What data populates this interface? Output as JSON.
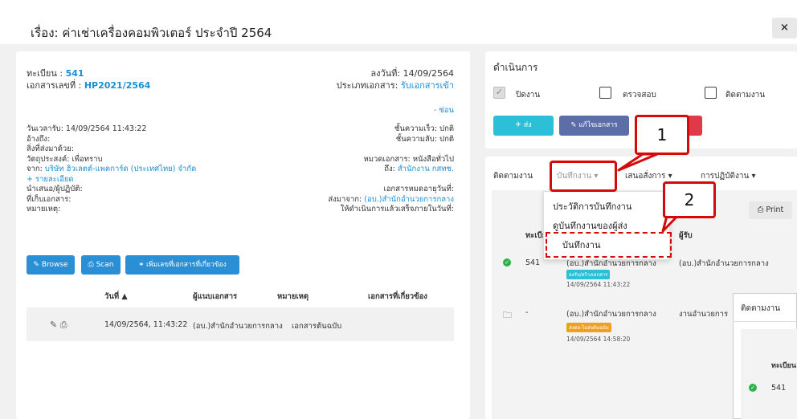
{
  "header": {
    "title": "เรื่อง: ค่าเช่าเครื่องคอมพิวเตอร์ ประจำปี 2564",
    "close": "×"
  },
  "doc": {
    "reg_label": "ทะเบียน :",
    "reg_value": "541",
    "docno_label": "เอกสารเลขที่ :",
    "docno_value": "HP2021/2564",
    "sign_date": "ลงวันที่: 14/09/2564",
    "doctype_label": "ประเภทเอกสาร:",
    "doctype_value": "รับเอกสารเข้า",
    "hide": "- ซ่อน",
    "received": "วันเวลารับ: 14/09/2564 11:43:22",
    "ref": "อ้างถึง:",
    "attach": "สิ่งที่ส่งมาด้วย:",
    "purpose": "วัตถุประสงค์: เพื่อทราบ",
    "from_label": "จาก:",
    "from_value": "บริษัท ฮิวเลตต์-แพคการ์ด (ประเทศไทย) จำกัด",
    "details": "+ รายละเอียด",
    "present": "นำเสนอ/ผู้ปฏิบัติ:",
    "storage": "ที่เก็บเอกสาร:",
    "note": "หมายเหตุ:",
    "speed": "ชั้นความเร็ว: ปกติ",
    "secret": "ชั้นความลับ: ปกติ",
    "category": "หมวดเอกสาร: หนังสือทั่วไป",
    "to_label": "ถึง:",
    "to_value": "สำนักงาน กสทช.",
    "expire": "เอกสารหมดอายุวันที่:",
    "sent_label": "ส่งมาจาก:",
    "sent_value": "(อบ.)สำนักอำนวยการกลาง",
    "due": "ให้ดำเนินการแล้วเสร็จภายในวันที่:"
  },
  "buttons": {
    "browse": "Browse",
    "scan": "Scan",
    "add_related": "เพิ่มเลขที่เอกสารที่เกี่ยวข้อง"
  },
  "attach_table": {
    "headers": [
      "วันที่ ▲",
      "ผู้แนบเอกสาร",
      "หมายเหตุ",
      "เอกสารที่เกี่ยวข้อง"
    ],
    "row": {
      "date": "14/09/2564, 11:43:22",
      "by": "(อบ.)สำนักอำนวยการกลาง",
      "note": "เอกสารต้นฉบับ"
    }
  },
  "action": {
    "title": "ดำเนินการ",
    "close_job": "ปิดงาน",
    "check": "ตรวจสอบ",
    "follow": "ติดตามงาน",
    "send": "ส่ง",
    "edit": "แก้ไขเอกสาร"
  },
  "tabs": {
    "follow": "ติดตามงาน",
    "record": "บันทึกงาน ▾",
    "propose": "เสนอสั่งการ ▾",
    "operate": "การปฏิบัติงาน ▾"
  },
  "dropdown": {
    "items": [
      "ประวัติการบันทึกงาน",
      "ดูบันทึกงานของผู้ส่ง",
      "บันทึกงาน"
    ]
  },
  "callouts": [
    "1",
    "2"
  ],
  "flow": {
    "print": "Print",
    "col_reg": "ทะเบีย",
    "col_receiver": "ผู้รับ",
    "rows": [
      {
        "reg": "541",
        "sender": "(อบ.)สำนักอำนวยการกลาง",
        "receiver": "(อบ.)สำนักอำนวยการกลาง",
        "badge": "ลงรับ/สร้างเอกสาร",
        "time": "14/09/2564 11:43:22",
        "badge_color": "#2bc0d8"
      },
      {
        "reg": "-",
        "sender": "(อบ.)สำนักอำนวยการกลาง",
        "receiver": "งานอำนวยการ",
        "badge": "ส่งต่อ-ไม่ส่งต้นฉบับ",
        "time": "14/09/2564 14:58:20",
        "badge_color": "#f0a020"
      }
    ]
  },
  "popup": {
    "title": "ติดตามงาน",
    "col_reg": "ทะเบียน",
    "reg": "541"
  },
  "colors": {
    "accent": "#1a8fd6",
    "success": "#2bb34a",
    "danger": "#e0394a",
    "teal": "#2bc0d8",
    "callout": "#d40a0a"
  }
}
